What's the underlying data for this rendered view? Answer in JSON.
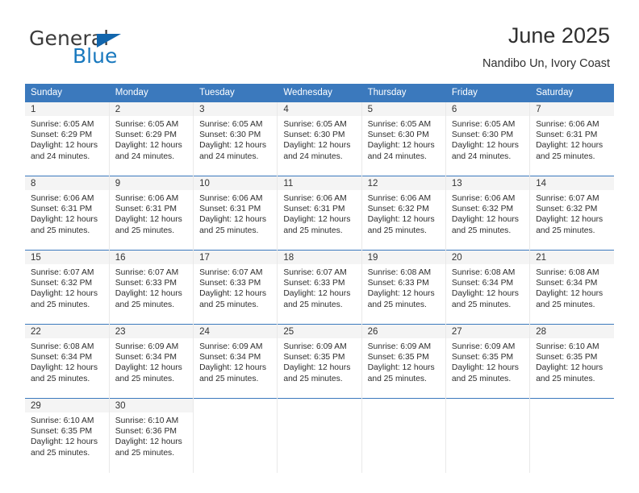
{
  "brand": {
    "name_top": "General",
    "name_bottom": "Blue",
    "flag_icon": "triangle-flag-icon",
    "color_blue": "#1878be",
    "color_flag": "#1266ad"
  },
  "header": {
    "title": "June 2025",
    "subtitle": "Nandibo Un, Ivory Coast"
  },
  "calendar": {
    "header_bg": "#3b79bd",
    "daynum_bg": "#f4f4f4",
    "weekday_headers": [
      "Sunday",
      "Monday",
      "Tuesday",
      "Wednesday",
      "Thursday",
      "Friday",
      "Saturday"
    ],
    "weeks": [
      [
        {
          "day": "1",
          "sunrise": "Sunrise: 6:05 AM",
          "sunset": "Sunset: 6:29 PM",
          "daylight_1": "Daylight: 12 hours",
          "daylight_2": "and 24 minutes."
        },
        {
          "day": "2",
          "sunrise": "Sunrise: 6:05 AM",
          "sunset": "Sunset: 6:29 PM",
          "daylight_1": "Daylight: 12 hours",
          "daylight_2": "and 24 minutes."
        },
        {
          "day": "3",
          "sunrise": "Sunrise: 6:05 AM",
          "sunset": "Sunset: 6:30 PM",
          "daylight_1": "Daylight: 12 hours",
          "daylight_2": "and 24 minutes."
        },
        {
          "day": "4",
          "sunrise": "Sunrise: 6:05 AM",
          "sunset": "Sunset: 6:30 PM",
          "daylight_1": "Daylight: 12 hours",
          "daylight_2": "and 24 minutes."
        },
        {
          "day": "5",
          "sunrise": "Sunrise: 6:05 AM",
          "sunset": "Sunset: 6:30 PM",
          "daylight_1": "Daylight: 12 hours",
          "daylight_2": "and 24 minutes."
        },
        {
          "day": "6",
          "sunrise": "Sunrise: 6:05 AM",
          "sunset": "Sunset: 6:30 PM",
          "daylight_1": "Daylight: 12 hours",
          "daylight_2": "and 24 minutes."
        },
        {
          "day": "7",
          "sunrise": "Sunrise: 6:06 AM",
          "sunset": "Sunset: 6:31 PM",
          "daylight_1": "Daylight: 12 hours",
          "daylight_2": "and 25 minutes."
        }
      ],
      [
        {
          "day": "8",
          "sunrise": "Sunrise: 6:06 AM",
          "sunset": "Sunset: 6:31 PM",
          "daylight_1": "Daylight: 12 hours",
          "daylight_2": "and 25 minutes."
        },
        {
          "day": "9",
          "sunrise": "Sunrise: 6:06 AM",
          "sunset": "Sunset: 6:31 PM",
          "daylight_1": "Daylight: 12 hours",
          "daylight_2": "and 25 minutes."
        },
        {
          "day": "10",
          "sunrise": "Sunrise: 6:06 AM",
          "sunset": "Sunset: 6:31 PM",
          "daylight_1": "Daylight: 12 hours",
          "daylight_2": "and 25 minutes."
        },
        {
          "day": "11",
          "sunrise": "Sunrise: 6:06 AM",
          "sunset": "Sunset: 6:31 PM",
          "daylight_1": "Daylight: 12 hours",
          "daylight_2": "and 25 minutes."
        },
        {
          "day": "12",
          "sunrise": "Sunrise: 6:06 AM",
          "sunset": "Sunset: 6:32 PM",
          "daylight_1": "Daylight: 12 hours",
          "daylight_2": "and 25 minutes."
        },
        {
          "day": "13",
          "sunrise": "Sunrise: 6:06 AM",
          "sunset": "Sunset: 6:32 PM",
          "daylight_1": "Daylight: 12 hours",
          "daylight_2": "and 25 minutes."
        },
        {
          "day": "14",
          "sunrise": "Sunrise: 6:07 AM",
          "sunset": "Sunset: 6:32 PM",
          "daylight_1": "Daylight: 12 hours",
          "daylight_2": "and 25 minutes."
        }
      ],
      [
        {
          "day": "15",
          "sunrise": "Sunrise: 6:07 AM",
          "sunset": "Sunset: 6:32 PM",
          "daylight_1": "Daylight: 12 hours",
          "daylight_2": "and 25 minutes."
        },
        {
          "day": "16",
          "sunrise": "Sunrise: 6:07 AM",
          "sunset": "Sunset: 6:33 PM",
          "daylight_1": "Daylight: 12 hours",
          "daylight_2": "and 25 minutes."
        },
        {
          "day": "17",
          "sunrise": "Sunrise: 6:07 AM",
          "sunset": "Sunset: 6:33 PM",
          "daylight_1": "Daylight: 12 hours",
          "daylight_2": "and 25 minutes."
        },
        {
          "day": "18",
          "sunrise": "Sunrise: 6:07 AM",
          "sunset": "Sunset: 6:33 PM",
          "daylight_1": "Daylight: 12 hours",
          "daylight_2": "and 25 minutes."
        },
        {
          "day": "19",
          "sunrise": "Sunrise: 6:08 AM",
          "sunset": "Sunset: 6:33 PM",
          "daylight_1": "Daylight: 12 hours",
          "daylight_2": "and 25 minutes."
        },
        {
          "day": "20",
          "sunrise": "Sunrise: 6:08 AM",
          "sunset": "Sunset: 6:34 PM",
          "daylight_1": "Daylight: 12 hours",
          "daylight_2": "and 25 minutes."
        },
        {
          "day": "21",
          "sunrise": "Sunrise: 6:08 AM",
          "sunset": "Sunset: 6:34 PM",
          "daylight_1": "Daylight: 12 hours",
          "daylight_2": "and 25 minutes."
        }
      ],
      [
        {
          "day": "22",
          "sunrise": "Sunrise: 6:08 AM",
          "sunset": "Sunset: 6:34 PM",
          "daylight_1": "Daylight: 12 hours",
          "daylight_2": "and 25 minutes."
        },
        {
          "day": "23",
          "sunrise": "Sunrise: 6:09 AM",
          "sunset": "Sunset: 6:34 PM",
          "daylight_1": "Daylight: 12 hours",
          "daylight_2": "and 25 minutes."
        },
        {
          "day": "24",
          "sunrise": "Sunrise: 6:09 AM",
          "sunset": "Sunset: 6:34 PM",
          "daylight_1": "Daylight: 12 hours",
          "daylight_2": "and 25 minutes."
        },
        {
          "day": "25",
          "sunrise": "Sunrise: 6:09 AM",
          "sunset": "Sunset: 6:35 PM",
          "daylight_1": "Daylight: 12 hours",
          "daylight_2": "and 25 minutes."
        },
        {
          "day": "26",
          "sunrise": "Sunrise: 6:09 AM",
          "sunset": "Sunset: 6:35 PM",
          "daylight_1": "Daylight: 12 hours",
          "daylight_2": "and 25 minutes."
        },
        {
          "day": "27",
          "sunrise": "Sunrise: 6:09 AM",
          "sunset": "Sunset: 6:35 PM",
          "daylight_1": "Daylight: 12 hours",
          "daylight_2": "and 25 minutes."
        },
        {
          "day": "28",
          "sunrise": "Sunrise: 6:10 AM",
          "sunset": "Sunset: 6:35 PM",
          "daylight_1": "Daylight: 12 hours",
          "daylight_2": "and 25 minutes."
        }
      ],
      [
        {
          "day": "29",
          "sunrise": "Sunrise: 6:10 AM",
          "sunset": "Sunset: 6:35 PM",
          "daylight_1": "Daylight: 12 hours",
          "daylight_2": "and 25 minutes."
        },
        {
          "day": "30",
          "sunrise": "Sunrise: 6:10 AM",
          "sunset": "Sunset: 6:36 PM",
          "daylight_1": "Daylight: 12 hours",
          "daylight_2": "and 25 minutes."
        },
        {
          "day": "",
          "sunrise": "",
          "sunset": "",
          "daylight_1": "",
          "daylight_2": ""
        },
        {
          "day": "",
          "sunrise": "",
          "sunset": "",
          "daylight_1": "",
          "daylight_2": ""
        },
        {
          "day": "",
          "sunrise": "",
          "sunset": "",
          "daylight_1": "",
          "daylight_2": ""
        },
        {
          "day": "",
          "sunrise": "",
          "sunset": "",
          "daylight_1": "",
          "daylight_2": ""
        },
        {
          "day": "",
          "sunrise": "",
          "sunset": "",
          "daylight_1": "",
          "daylight_2": ""
        }
      ]
    ]
  }
}
